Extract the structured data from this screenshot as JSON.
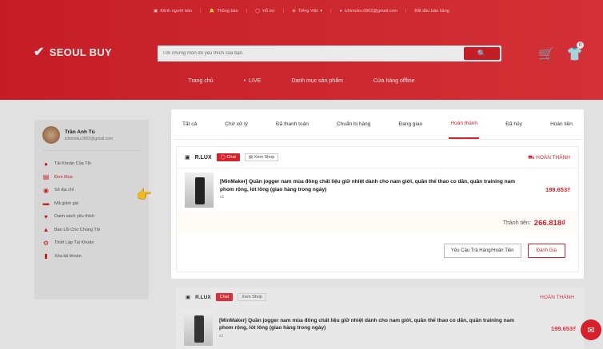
{
  "topbar": {
    "seller": "Kênh người bán",
    "notifications": "Thông báo",
    "support": "Hỗ trợ",
    "language": "Tiếng Việt",
    "email": "ichimoku.0902@gmail.com",
    "start_selling": "Bắt đầu bán hàng"
  },
  "header": {
    "logo": "SEOUL BUY",
    "search_placeholder": "Tìm những món đồ yêu thích của bạn.",
    "cart_icon": "cart-icon",
    "badge": "0"
  },
  "nav": [
    "Trang chủ",
    "LIVE",
    "Danh mục sản phẩm",
    "Cửa hàng offline"
  ],
  "profile": {
    "name": "Trần Anh Tú",
    "email": "ichimoku.0902@gmail.com"
  },
  "sidebar": [
    {
      "label": "Tài Khoản Của Tôi",
      "icon": "user-icon"
    },
    {
      "label": "Đơn Mua",
      "icon": "order-icon"
    },
    {
      "label": "Sổ địa chỉ",
      "icon": "location-icon"
    },
    {
      "label": "Mã giảm giá",
      "icon": "coupon-icon"
    },
    {
      "label": "Danh sách yêu thích",
      "icon": "heart-icon"
    },
    {
      "label": "Báo Lỗi Cho Chúng Tôi",
      "icon": "warning-icon"
    },
    {
      "label": "Thiết Lập Tài Khoản",
      "icon": "settings-icon"
    },
    {
      "label": "Xóa tài khoản",
      "icon": "trash-icon"
    }
  ],
  "tabs": [
    "Tất cả",
    "Chờ xử lý",
    "Đã thanh toán",
    "Chuẩn bị hàng",
    "Đang giao",
    "Hoàn thành",
    "Đã hủy",
    "Hoàn tiền"
  ],
  "order": {
    "shop": "R.LUX",
    "chat": "Chat",
    "view_shop": "Xem Shop",
    "status": "HOÀN THÀNH",
    "item_name": "[MinMaker] Quần jogger nam mùa đông chất liệu giữ nhiệt dành cho nam giới, quần thể thao co dãn, quần training nam phom rộng, lót lông (giao hàng trong ngày)",
    "qty": "x1",
    "price": "199.653₫",
    "total_label": "Thành tiền:",
    "total": "266.818₫",
    "return_btn": "Yêu Cầu Trả Hàng/Hoàn Tiền",
    "rate_btn": "Đánh Giá",
    "thumb_label": "MIN"
  },
  "order2": {
    "shop": "R.LUX",
    "chat": "Chat",
    "view_shop": "Xem Shop",
    "status": "HOÀN THÀNH",
    "item_name": "[MinMaker] Quần jogger nam mùa đông chất liệu giữ nhiệt dành cho nam giới, quần thể thao co dãn, quần training nam phom rộng, lót lông (giao hàng trong ngày)",
    "qty": "x1",
    "price": "199.653₫"
  }
}
